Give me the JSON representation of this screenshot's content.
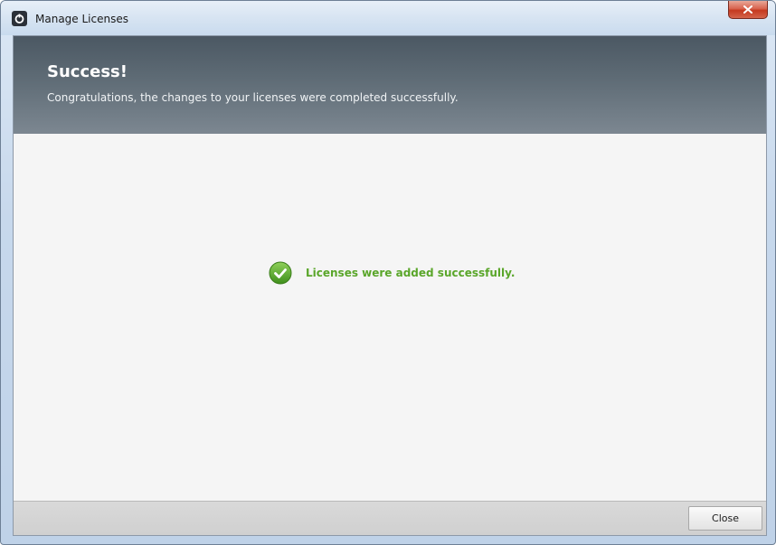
{
  "window": {
    "title": "Manage Licenses",
    "app_icon": "app-logo-icon",
    "close_icon": "close-icon"
  },
  "banner": {
    "title": "Success!",
    "subtitle": "Congratulations, the changes to your licenses were completed successfully."
  },
  "status": {
    "icon": "checkmark-icon",
    "message": "Licenses were added successfully.",
    "color": "#5aa62a"
  },
  "footer": {
    "close_label": "Close"
  },
  "colors": {
    "banner_dark": "#4b5863",
    "banner_light": "#7c8791",
    "success_green": "#5aa62a",
    "titlebar_close_red": "#c5391f"
  }
}
